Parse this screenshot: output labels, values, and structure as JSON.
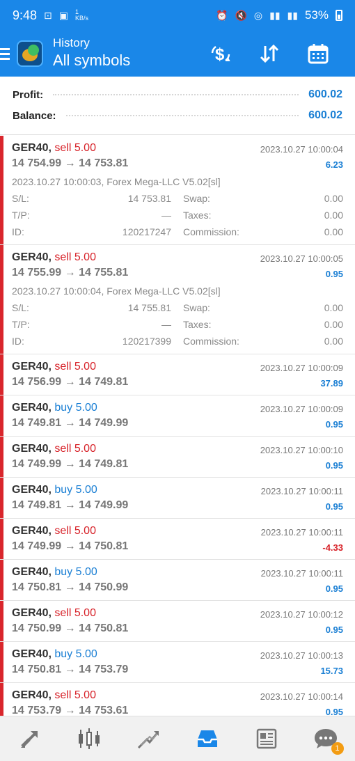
{
  "status_bar": {
    "time": "9:48",
    "net_speed": "1 KB/s",
    "battery": "53%"
  },
  "header": {
    "title": "History",
    "subtitle": "All symbols",
    "actions": [
      "dollar-sort-icon",
      "sort-arrows-icon",
      "calendar-icon"
    ]
  },
  "summary": {
    "profit_label": "Profit:",
    "profit_value": "600.02",
    "balance_label": "Balance:",
    "balance_value": "600.02"
  },
  "labels": {
    "sl": "S/L:",
    "tp": "T/P:",
    "id": "ID:",
    "swap": "Swap:",
    "taxes": "Taxes:",
    "commission": "Commission:"
  },
  "deals": [
    {
      "symbol": "GER40,",
      "direction": "sell 5.00",
      "dir": "sell",
      "prices": "14 754.99 → 14 753.81",
      "time": "2023.10.27 10:00:04",
      "profit": "6.23",
      "expanded": true,
      "comment": "2023.10.27 10:00:03, Forex Mega-LLC V5.02[sl]",
      "sl": "14 753.81",
      "tp": "—",
      "id": "120217247",
      "swap": "0.00",
      "taxes": "0.00",
      "commission": "0.00"
    },
    {
      "symbol": "GER40,",
      "direction": "sell 5.00",
      "dir": "sell",
      "prices": "14 755.99 → 14 755.81",
      "time": "2023.10.27 10:00:05",
      "profit": "0.95",
      "expanded": true,
      "comment": "2023.10.27 10:00:04, Forex Mega-LLC V5.02[sl]",
      "sl": "14 755.81",
      "tp": "—",
      "id": "120217399",
      "swap": "0.00",
      "taxes": "0.00",
      "commission": "0.00"
    },
    {
      "symbol": "GER40,",
      "direction": "sell 5.00",
      "dir": "sell",
      "prices": "14 756.99 → 14 749.81",
      "time": "2023.10.27 10:00:09",
      "profit": "37.89"
    },
    {
      "symbol": "GER40,",
      "direction": "buy 5.00",
      "dir": "buy",
      "prices": "14 749.81 → 14 749.99",
      "time": "2023.10.27 10:00:09",
      "profit": "0.95"
    },
    {
      "symbol": "GER40,",
      "direction": "sell 5.00",
      "dir": "sell",
      "prices": "14 749.99 → 14 749.81",
      "time": "2023.10.27 10:00:10",
      "profit": "0.95"
    },
    {
      "symbol": "GER40,",
      "direction": "buy 5.00",
      "dir": "buy",
      "prices": "14 749.81 → 14 749.99",
      "time": "2023.10.27 10:00:11",
      "profit": "0.95"
    },
    {
      "symbol": "GER40,",
      "direction": "sell 5.00",
      "dir": "sell",
      "prices": "14 749.99 → 14 750.81",
      "time": "2023.10.27 10:00:11",
      "profit": "-4.33"
    },
    {
      "symbol": "GER40,",
      "direction": "buy 5.00",
      "dir": "buy",
      "prices": "14 750.81 → 14 750.99",
      "time": "2023.10.27 10:00:11",
      "profit": "0.95"
    },
    {
      "symbol": "GER40,",
      "direction": "sell 5.00",
      "dir": "sell",
      "prices": "14 750.99 → 14 750.81",
      "time": "2023.10.27 10:00:12",
      "profit": "0.95"
    },
    {
      "symbol": "GER40,",
      "direction": "buy 5.00",
      "dir": "buy",
      "prices": "14 750.81 → 14 753.79",
      "time": "2023.10.27 10:00:13",
      "profit": "15.73"
    },
    {
      "symbol": "GER40,",
      "direction": "sell 5.00",
      "dir": "sell",
      "prices": "14 753.79 → 14 753.61",
      "time": "2023.10.27 10:00:14",
      "profit": "0.95"
    }
  ],
  "bottom_nav": {
    "items": [
      "quotes-icon",
      "chart-icon",
      "trade-icon",
      "history-icon",
      "news-icon",
      "messages-icon"
    ],
    "active": "history-icon",
    "messages_badge": "1"
  },
  "colors": {
    "header_bg": "#1a87e8",
    "sell": "#d72128",
    "buy": "#1a7fd4",
    "profit_positive": "#1a7fd4",
    "profit_negative": "#d72128",
    "row_marker": "#d9262c"
  }
}
